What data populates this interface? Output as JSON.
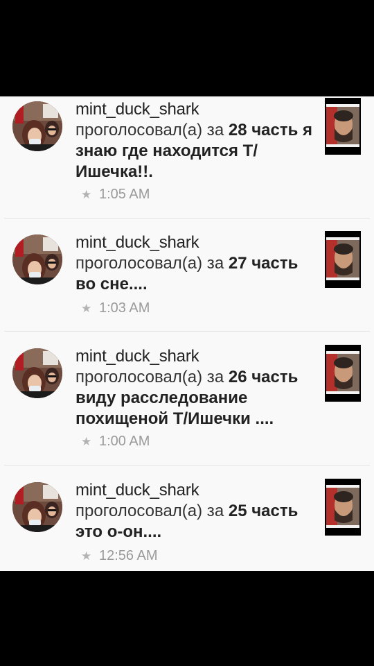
{
  "notifications": [
    {
      "username": "mint_duck_shark",
      "action": "проголосовал(а) за",
      "part": "28 часть",
      "title": "я знаю где находится Т/Ишечка!!.",
      "time": "1:05 AM"
    },
    {
      "username": "mint_duck_shark",
      "action": "проголосовал(а) за",
      "part": "27 часть",
      "title": "во сне....",
      "time": "1:03 AM"
    },
    {
      "username": "mint_duck_shark",
      "action": "проголосовал(а) за",
      "part": "26 часть",
      "title": "виду расследование похищеной Т/Ишечки ....",
      "time": "1:00 AM"
    },
    {
      "username": "mint_duck_shark",
      "action": "проголосовал(а) за",
      "part": "25 часть",
      "title": "это о-он....",
      "time": "12:56 AM"
    }
  ],
  "icons": {
    "star": "star-icon"
  },
  "colors": {
    "background": "#f9f9f9",
    "text": "#333333",
    "timestamp": "#9a9a9a",
    "divider": "#e3e3e3"
  }
}
